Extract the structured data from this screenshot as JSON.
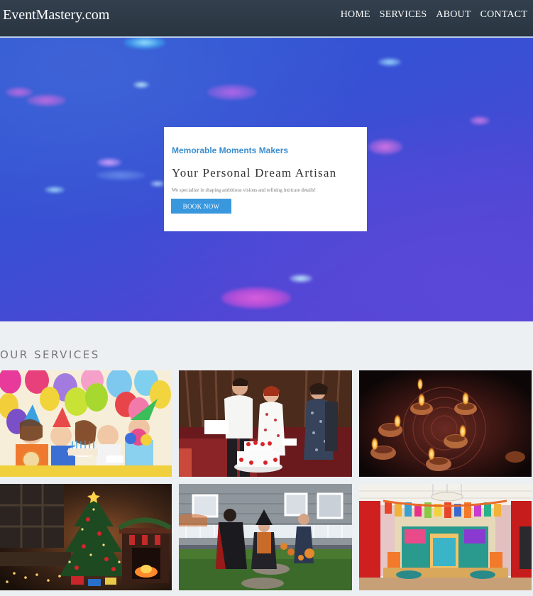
{
  "navbar": {
    "brand": "EventMastery.com",
    "links": [
      {
        "label": "HOME"
      },
      {
        "label": "SERVICES"
      },
      {
        "label": "ABOUT"
      },
      {
        "label": "CONTACT"
      }
    ]
  },
  "hero": {
    "subtitle": "Memorable Moments Makers",
    "title": "Your Personal Dream Artisan",
    "description": "We specialize in shaping ambitious visions and refining intricate details!",
    "button_label": "BOOK NOW"
  },
  "services": {
    "heading": "OUR SERVICES",
    "items": [
      {
        "image": "kids-birthday-party"
      },
      {
        "image": "wedding-cake-cutting"
      },
      {
        "image": "diwali-diya-lamps"
      },
      {
        "image": "christmas-tree-living-room"
      },
      {
        "image": "halloween-trick-or-treat"
      },
      {
        "image": "decorated-wedding-stage"
      }
    ]
  },
  "colors": {
    "nav_bg": "#2e3a47",
    "accent": "#3997dd",
    "subtitle": "#3a8ed0",
    "hero_bg": "#3c50d4",
    "page_bg": "#edf0f2"
  }
}
